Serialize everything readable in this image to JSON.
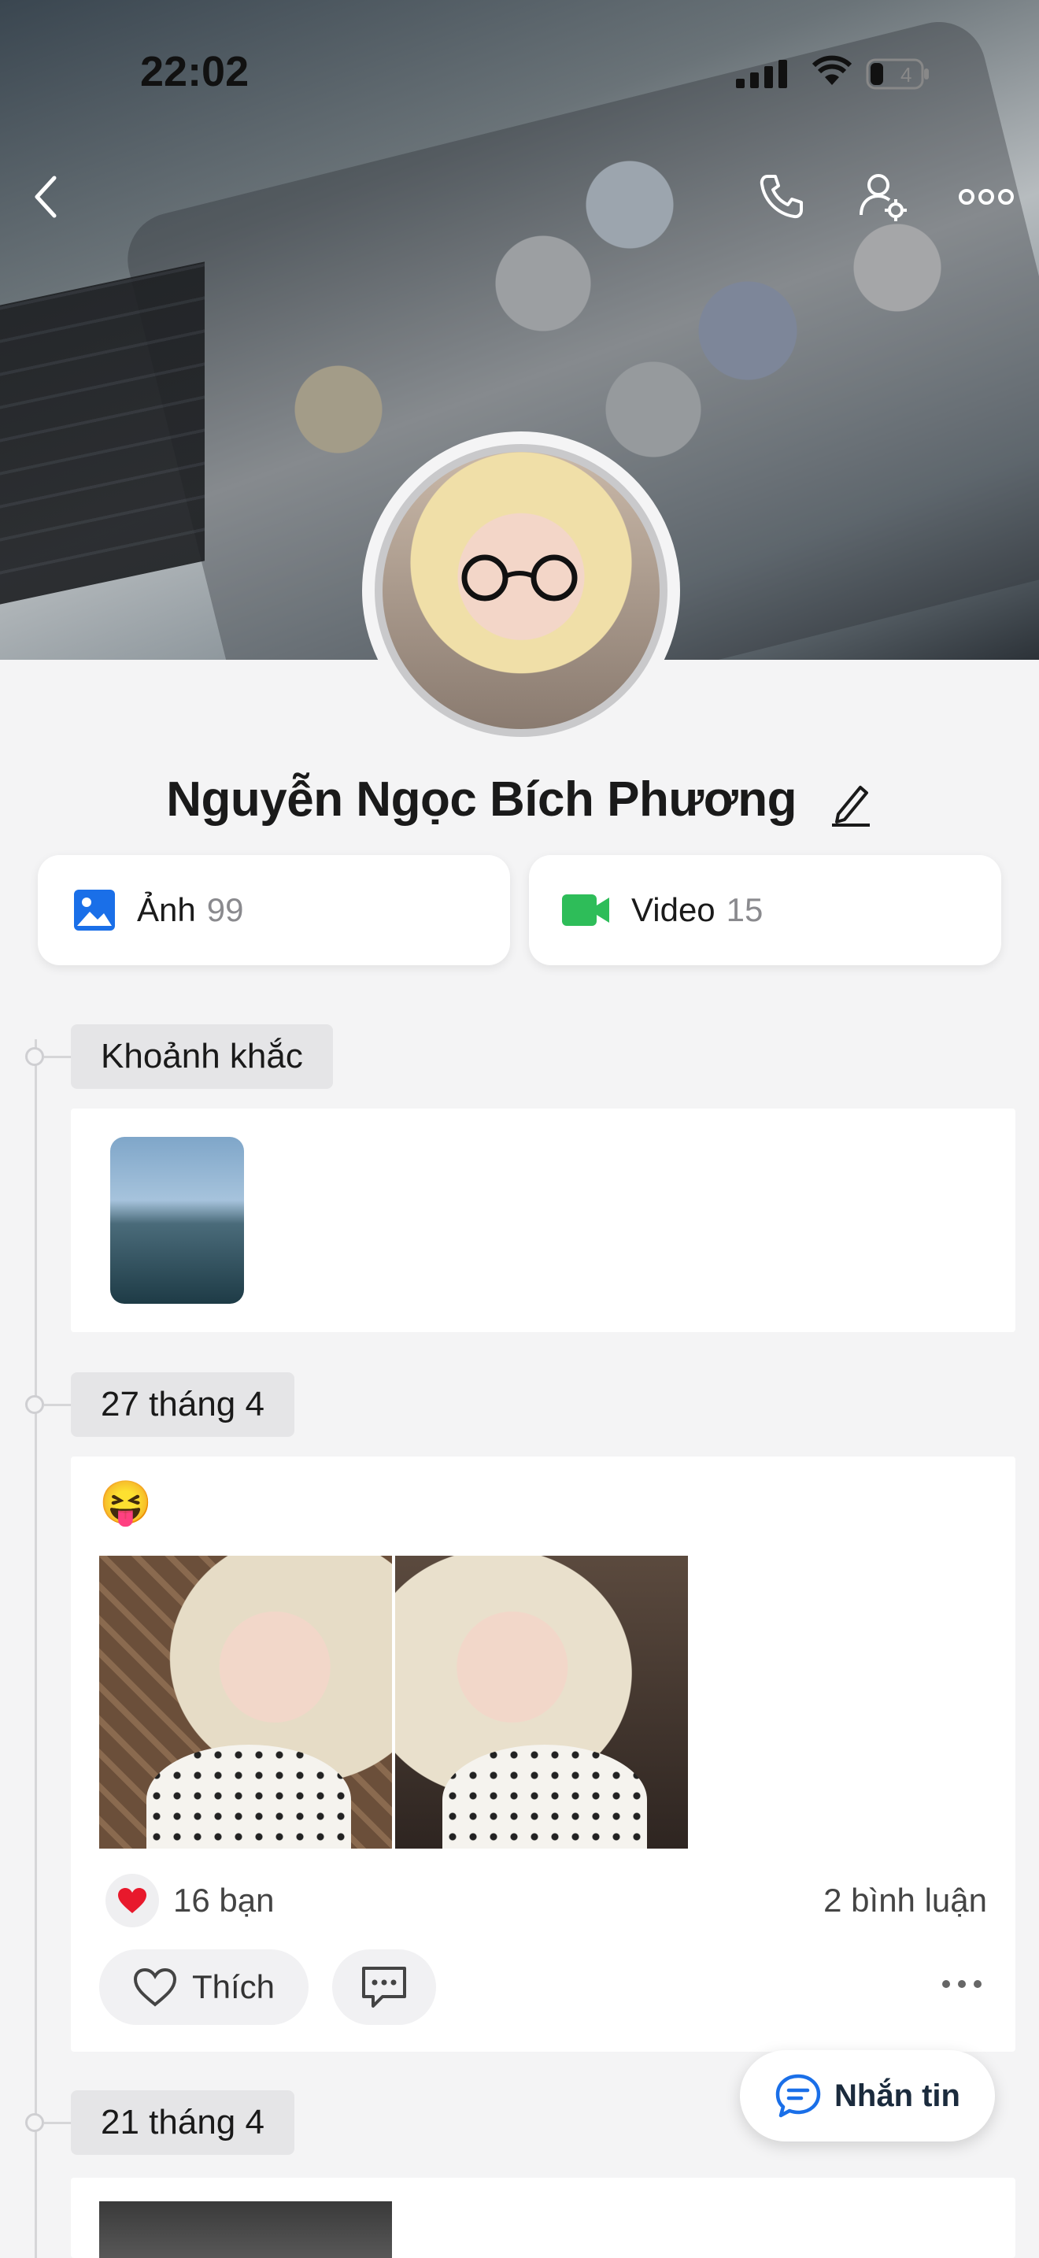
{
  "status_bar": {
    "time": "22:02",
    "battery": "4"
  },
  "profile": {
    "name": "Nguyễn Ngọc Bích Phương"
  },
  "media": [
    {
      "label": "Ảnh",
      "count": "99"
    },
    {
      "label": "Video",
      "count": "15"
    }
  ],
  "sections": {
    "moments_title": "Khoảnh khắc",
    "posts": [
      {
        "date": "27 tháng 4",
        "emoji": "😝",
        "reactions": "16 bạn",
        "comments": "2 bình luận",
        "like_label": "Thích"
      },
      {
        "date": "21 tháng 4"
      }
    ]
  },
  "message_button": {
    "label": "Nhắn tin"
  },
  "colors": {
    "photo_icon": "#1a6fe8",
    "video_icon": "#2ebd59",
    "chat_accent": "#1a6fe8",
    "heart": "#e8192c"
  }
}
